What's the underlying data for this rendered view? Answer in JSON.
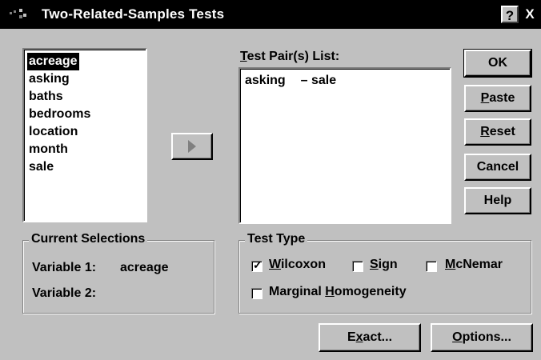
{
  "window": {
    "title": "Two-Related-Samples Tests",
    "help_button": "?",
    "close_button": "X"
  },
  "variables": [
    "acreage",
    "asking",
    "baths",
    "bedrooms",
    "location",
    "month",
    "sale"
  ],
  "selected_variable": "acreage",
  "test_pairs": {
    "label_prefix": "",
    "label": "Test Pair(s) List:",
    "items": [
      {
        "var1": "asking",
        "sep": "–",
        "var2": "sale"
      }
    ]
  },
  "buttons": {
    "ok": "OK",
    "paste": "Paste",
    "reset": "Reset",
    "cancel": "Cancel",
    "help": "Help",
    "exact": "Exact...",
    "options": "Options..."
  },
  "current_selections": {
    "title": "Current Selections",
    "variable1_label": "Variable 1:",
    "variable1_value": "acreage",
    "variable2_label": "Variable 2:",
    "variable2_value": ""
  },
  "test_type": {
    "title": "Test Type",
    "wilcoxon": {
      "label": "Wilcoxon",
      "checked": true
    },
    "sign": {
      "label": "Sign",
      "checked": false
    },
    "mcnemar": {
      "label": "McNemar",
      "checked": false
    },
    "marginal_homogeneity": {
      "label": "Marginal Homogeneity",
      "checked": false
    }
  },
  "colors": {
    "titlebar": "#000000",
    "dialog_face": "#c0c0c0",
    "selection": "#000000"
  },
  "icons": {
    "window_icon": "spss-icon",
    "move_arrow": "arrow-right-icon"
  }
}
